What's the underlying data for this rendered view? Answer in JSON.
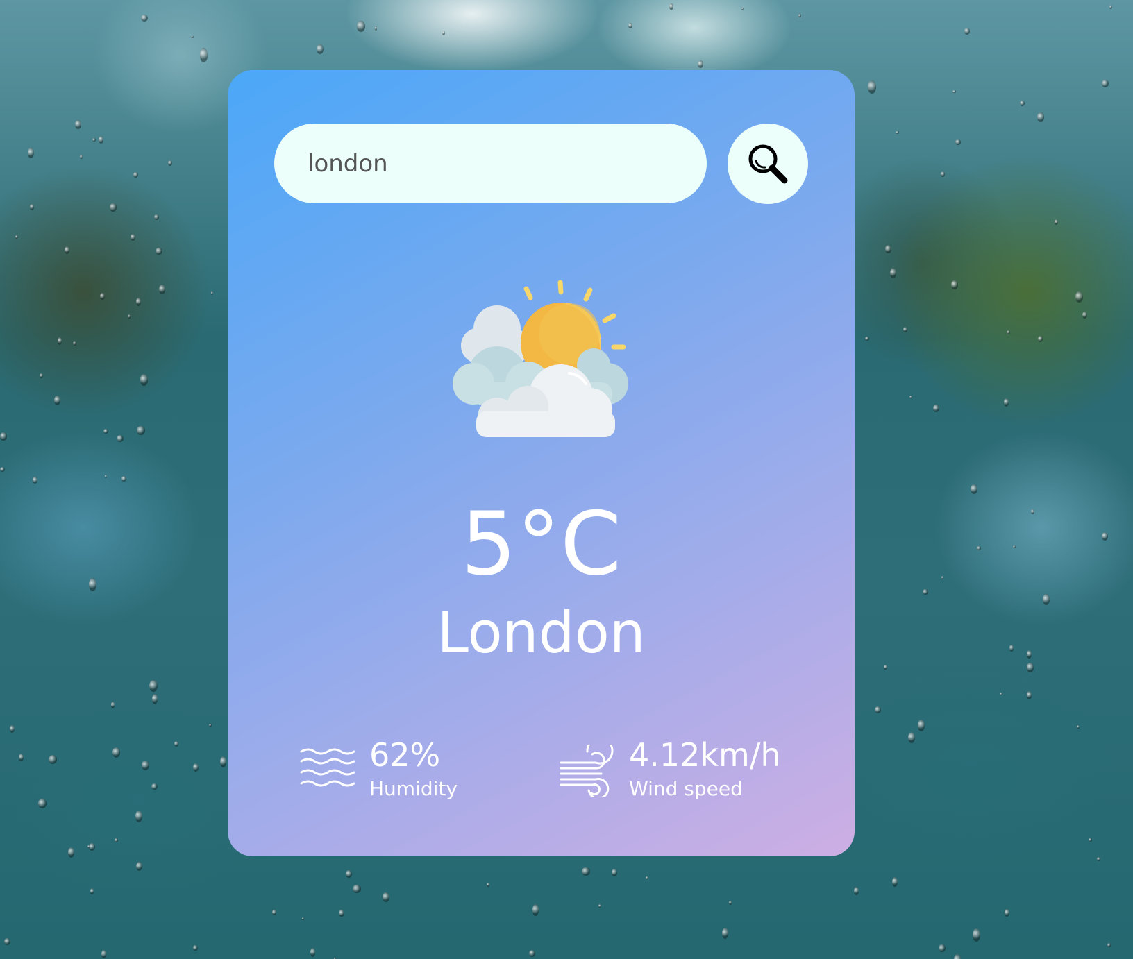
{
  "search": {
    "value": "london",
    "button_icon": "search-icon"
  },
  "weather": {
    "condition_icon": "partly-cloudy-icon",
    "temperature": "5°C",
    "city": "London"
  },
  "details": {
    "humidity": {
      "icon": "humidity-waves-icon",
      "value": "62%",
      "label": "Humidity"
    },
    "wind": {
      "icon": "wind-icon",
      "value": "4.12km/h",
      "label": "Wind speed"
    }
  },
  "colors": {
    "card_gradient_start": "#4ba8f8",
    "card_gradient_end": "#cdaee3",
    "input_background": "#ecfffa",
    "text": "#ffffff",
    "sun": "#f3b844",
    "cloud": "#eef3f6"
  }
}
